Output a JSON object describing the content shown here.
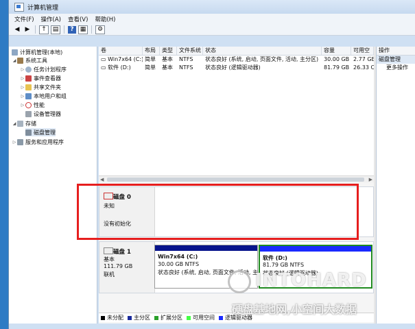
{
  "window": {
    "title": "计算机管理"
  },
  "menu": [
    "文件(F)",
    "操作(A)",
    "查看(V)",
    "帮助(H)"
  ],
  "tree": {
    "root": "计算机管理(本地)",
    "system_tools": "系统工具",
    "task_scheduler": "任务计划程序",
    "event_viewer": "事件查看器",
    "shared_folders": "共享文件夹",
    "local_users": "本地用户和组",
    "performance": "性能",
    "device_manager": "设备管理器",
    "storage": "存储",
    "disk_management": "磁盘管理",
    "services_apps": "服务和应用程序"
  },
  "table": {
    "headers": [
      "卷",
      "布局",
      "类型",
      "文件系统",
      "状态",
      "容量",
      "可用空"
    ],
    "rows": [
      {
        "vol": "Win7x64 (C:)",
        "layout": "简单",
        "type": "基本",
        "fs": "NTFS",
        "status": "状态良好 (系统, 启动, 页面文件, 活动, 主分区)",
        "cap": "30.00 GB",
        "free": "2.77 GE"
      },
      {
        "vol": "软件 (D:)",
        "layout": "简单",
        "type": "基本",
        "fs": "NTFS",
        "status": "状态良好 (逻辑驱动器)",
        "cap": "81.79 GB",
        "free": "26.33 C"
      }
    ]
  },
  "disk0": {
    "name": "磁盘 0",
    "state": "未知",
    "init": "没有初始化"
  },
  "disk1": {
    "name": "磁盘 1",
    "type": "基本",
    "size": "111.79 GB",
    "status": "联机",
    "partC": {
      "label": "Win7x64  (C:)",
      "size": "30.00 GB NTFS",
      "status": "状态良好 (系统, 启动, 页面文件, 活动, 主"
    },
    "partD": {
      "label": "软件  (D:)",
      "size": "81.79 GB NTFS",
      "status": "状态良好 (逻辑驱动器)"
    }
  },
  "legend": [
    {
      "label": "未分配",
      "color": "#000000"
    },
    {
      "label": "主分区",
      "color": "#1a2a9c"
    },
    {
      "label": "扩展分区",
      "color": "#2aa02a"
    },
    {
      "label": "可用空间",
      "color": "#44ff44"
    },
    {
      "label": "逻辑驱动器",
      "color": "#1a2aff"
    }
  ],
  "actions": {
    "header": "操作",
    "section": "磁盘管理",
    "more": "更多操作"
  },
  "watermark": {
    "brand": "INTOHARD",
    "slogan": "硬盘基地网,小空间大数据"
  }
}
